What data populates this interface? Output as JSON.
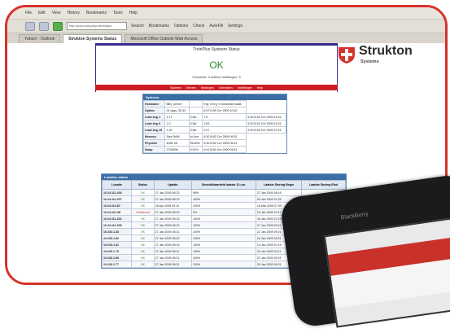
{
  "browser": {
    "menu": [
      "File",
      "Edit",
      "View",
      "History",
      "Bookmarks",
      "Tools",
      "Help"
    ],
    "address": "http://pda.company.net/status",
    "toolbar_labels": [
      "Search",
      "Bookmarks",
      "Options",
      "Check",
      "AutoFill",
      "Settings"
    ],
    "tabs": [
      "Yahoo! - Outlook",
      "Strukton Systems Status",
      "Microsoft Office Outlook Web Access"
    ]
  },
  "header": {
    "title": "TreinPlus Systeem Status",
    "ok": "OK",
    "subtitle": "Overzicht: 3 actieve meldingen: 3",
    "nav": [
      "Systeem",
      "Servers",
      "Meldingen",
      "Gebruikers",
      "Instellingen",
      "Help"
    ],
    "brand": "Strukton",
    "brand_sub": "Systems",
    "brand_color": "#d6322b"
  },
  "system": {
    "heading": "Systeem",
    "rows": [
      [
        "Hostname",
        "BB1_server",
        "",
        "Erg: 0 Erg: 0 Uitvoerde loads"
      ],
      [
        "Uptime",
        "24 days, 20:33",
        "",
        "5:37 B:55 Cre 2009 10:40"
      ],
      [
        "Load Avg 1",
        "1.17",
        "0.5kr",
        "1.9",
        "5:30 B:52 Cre 2009 10:41"
      ],
      [
        "Load Avg 5",
        "1.0",
        "0.5kr",
        "3.63",
        "5:30 B:52 Cre 2009 10:31"
      ],
      [
        "Load Avg 15",
        "1.49",
        "0.5kr",
        "3.27",
        "5:30 B:52 Cre 2009 10:21"
      ],
      [
        "Memory",
        "Size RAM",
        "In Use",
        "5:30 B:52 Cre 2009 09:31"
      ],
      [
        "Physical",
        "4096 1B",
        "96.60%",
        "5:30 B:52 Cre 2009 09:41"
      ],
      [
        "Swap",
        "3734936",
        "0.01%",
        "5:41 B:54 Cre 2009 09:41"
      ]
    ]
  },
  "servers": {
    "heading": "Locaties status",
    "columns": [
      "Locatie",
      "Status",
      "Update",
      "Beschikbaarheid laatste 12 uur",
      "Laatste Storing Begin",
      "Laatste Storing Eind"
    ],
    "rows": [
      [
        "10.24.111.200",
        "OK",
        "27 Jan 2009 08:23",
        "99%",
        "27 Jan 2009 08:19",
        ""
      ],
      [
        "10.24.111.207",
        "OK",
        "27 Jan 2009 08:23",
        "100%",
        "26 Jan 2009 21:25",
        ""
      ],
      [
        "10.24.113.87",
        "OK",
        "28 Apr 2008 09:10",
        "100%",
        "18 Mar 2008 07:09",
        ""
      ],
      [
        "10.24.121.38",
        "Onbekend",
        "27 Jan 2009 08:23",
        "0%",
        "19 Jan 2009 10:17",
        ""
      ],
      [
        "10.24.111.202",
        "OK",
        "27 Jan 2009 08:23",
        "100%",
        "26 Jan 2009 22:19",
        ""
      ],
      [
        "10.24.111.205",
        "OK",
        "27 Jan 2009 08:23",
        "100%",
        "27 Jan 2009 03:11",
        ""
      ],
      [
        "10.233.1.83",
        "OK",
        "27 Jan 2009 08:21",
        "100%",
        "22 Jan 2009 09:21",
        ""
      ],
      [
        "10.233.1.82",
        "OK",
        "27 Jan 2009 08:20",
        "100%",
        "26 Jan 2009 09:21",
        ""
      ],
      [
        "10.233.1.81",
        "OK",
        "27 Jan 2009 08:19",
        "100%",
        "14 Jan 2009 07:19",
        ""
      ],
      [
        "10.233.1.79",
        "OK",
        "27 Jan 2009 08:21",
        "100%",
        "23 Jan 2009 03:11",
        ""
      ],
      [
        "10.233.1.80",
        "OK",
        "27 Jan 2009 08:21",
        "100%",
        "22 Jan 2009 09:21",
        ""
      ],
      [
        "10.233.1.77",
        "OK",
        "27 Jan 2009 08:21",
        "100%",
        "26 Jan 2009 09:21",
        ""
      ]
    ]
  },
  "phone": {
    "brand": "BlackBerry"
  }
}
